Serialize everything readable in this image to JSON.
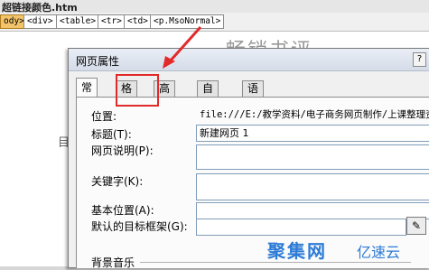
{
  "window": {
    "file_title": "超链接颜色.htm"
  },
  "tag_selector": {
    "tags": [
      "ody>",
      "<div>",
      "<table>",
      "<tr>",
      "<td>",
      "<p.MsoNormal>"
    ]
  },
  "document": {
    "heading": "畅销书评",
    "side_char": "目"
  },
  "dialog": {
    "title": "网页属性",
    "help_label": "?",
    "tabs": [
      "常规",
      "格式",
      "高级",
      "自定义",
      "语言"
    ],
    "active_tab": "常规",
    "highlighted_tab": "格式",
    "fields": {
      "location": {
        "label": "位置:",
        "value": "file:///E:/教学资料/电子商务网页制作/上课整理资料"
      },
      "title": {
        "label": "标题(T):",
        "value": "新建网页 1"
      },
      "description": {
        "label": "网页说明(P):",
        "value": ""
      },
      "keywords": {
        "label": "关键字(K):",
        "value": ""
      },
      "base_location": {
        "label": "基本位置(A):",
        "value": ""
      },
      "default_target_frame": {
        "label": "默认的目标框架(G):",
        "value": ""
      }
    },
    "browse_button": "✎",
    "background_sound_label": "背景音乐"
  },
  "watermark": {
    "logo_text": "聚集网",
    "brand": "亿速云"
  },
  "colors": {
    "highlight": "#e12a2a",
    "arrow": "#e12a2a",
    "watermark": "#2d7bd6"
  }
}
